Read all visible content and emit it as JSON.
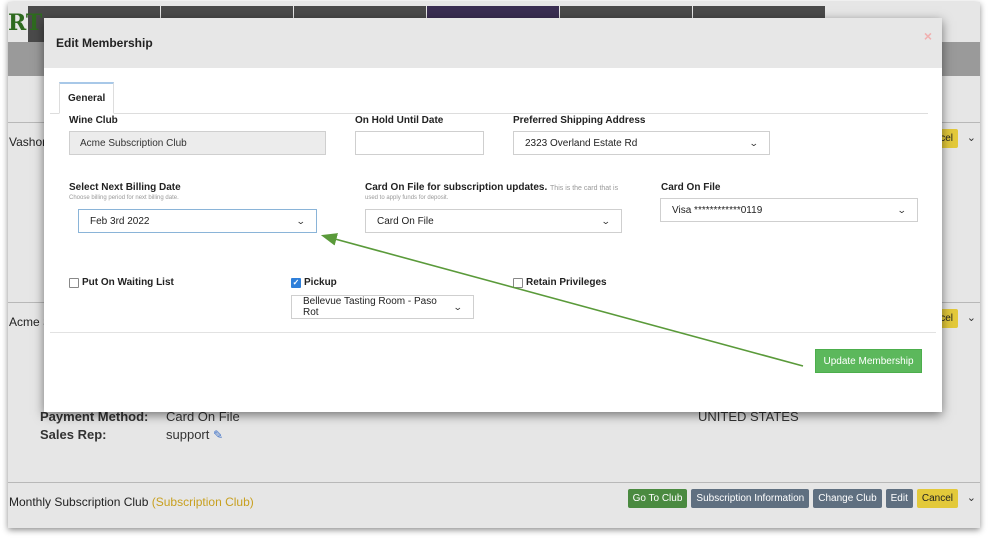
{
  "background": {
    "logo_text": "RT",
    "sections": [
      {
        "title": "Vashon",
        "subtitle": ""
      },
      {
        "title": "Acme S",
        "subtitle": ""
      },
      {
        "title": "Monthly Subscription Club ",
        "subtitle": "(Subscription Club)"
      }
    ],
    "buttons": {
      "go_to_club": "Go To Club",
      "subscription_info": "Subscription Information",
      "change_club": "Change Club",
      "edit": "Edit",
      "cancel": "Cancel"
    },
    "fields": {
      "payment_method_label": "Payment Method:",
      "payment_method_value": "Card On File",
      "sales_rep_label": "Sales Rep:",
      "sales_rep_value": "support",
      "country": "UNITED STATES"
    }
  },
  "modal": {
    "title": "Edit Membership",
    "close_symbol": "×",
    "tabs": [
      {
        "label": "General"
      }
    ],
    "wine_club": {
      "label": "Wine Club",
      "value": "Acme Subscription Club"
    },
    "on_hold": {
      "label": "On Hold Until Date",
      "value": ""
    },
    "shipping": {
      "label": "Preferred Shipping Address",
      "value": "2323 Overland Estate Rd"
    },
    "billing_date": {
      "label": "Select Next Billing Date",
      "help": "Choose billing period for next billing date.",
      "value": "Feb 3rd 2022"
    },
    "card_updates": {
      "label": "Card On File for subscription updates.",
      "help_inline": "This is the card that is",
      "help": "used to apply funds for deposit.",
      "value": "Card On File"
    },
    "card_on_file": {
      "label": "Card On File",
      "value": "Visa ************0119"
    },
    "waiting_list": {
      "label": "Put On Waiting List",
      "checked": false
    },
    "pickup": {
      "label": "Pickup",
      "checked": true,
      "location": "Bellevue Tasting Room - Paso Rot"
    },
    "retain": {
      "label": "Retain Privileges",
      "checked": false
    },
    "update_button": "Update Membership"
  },
  "colors": {
    "update_button": "#5cb85c",
    "annotation_arrow": "#5a9a3a",
    "checkbox_checked": "#2f7fd9"
  }
}
